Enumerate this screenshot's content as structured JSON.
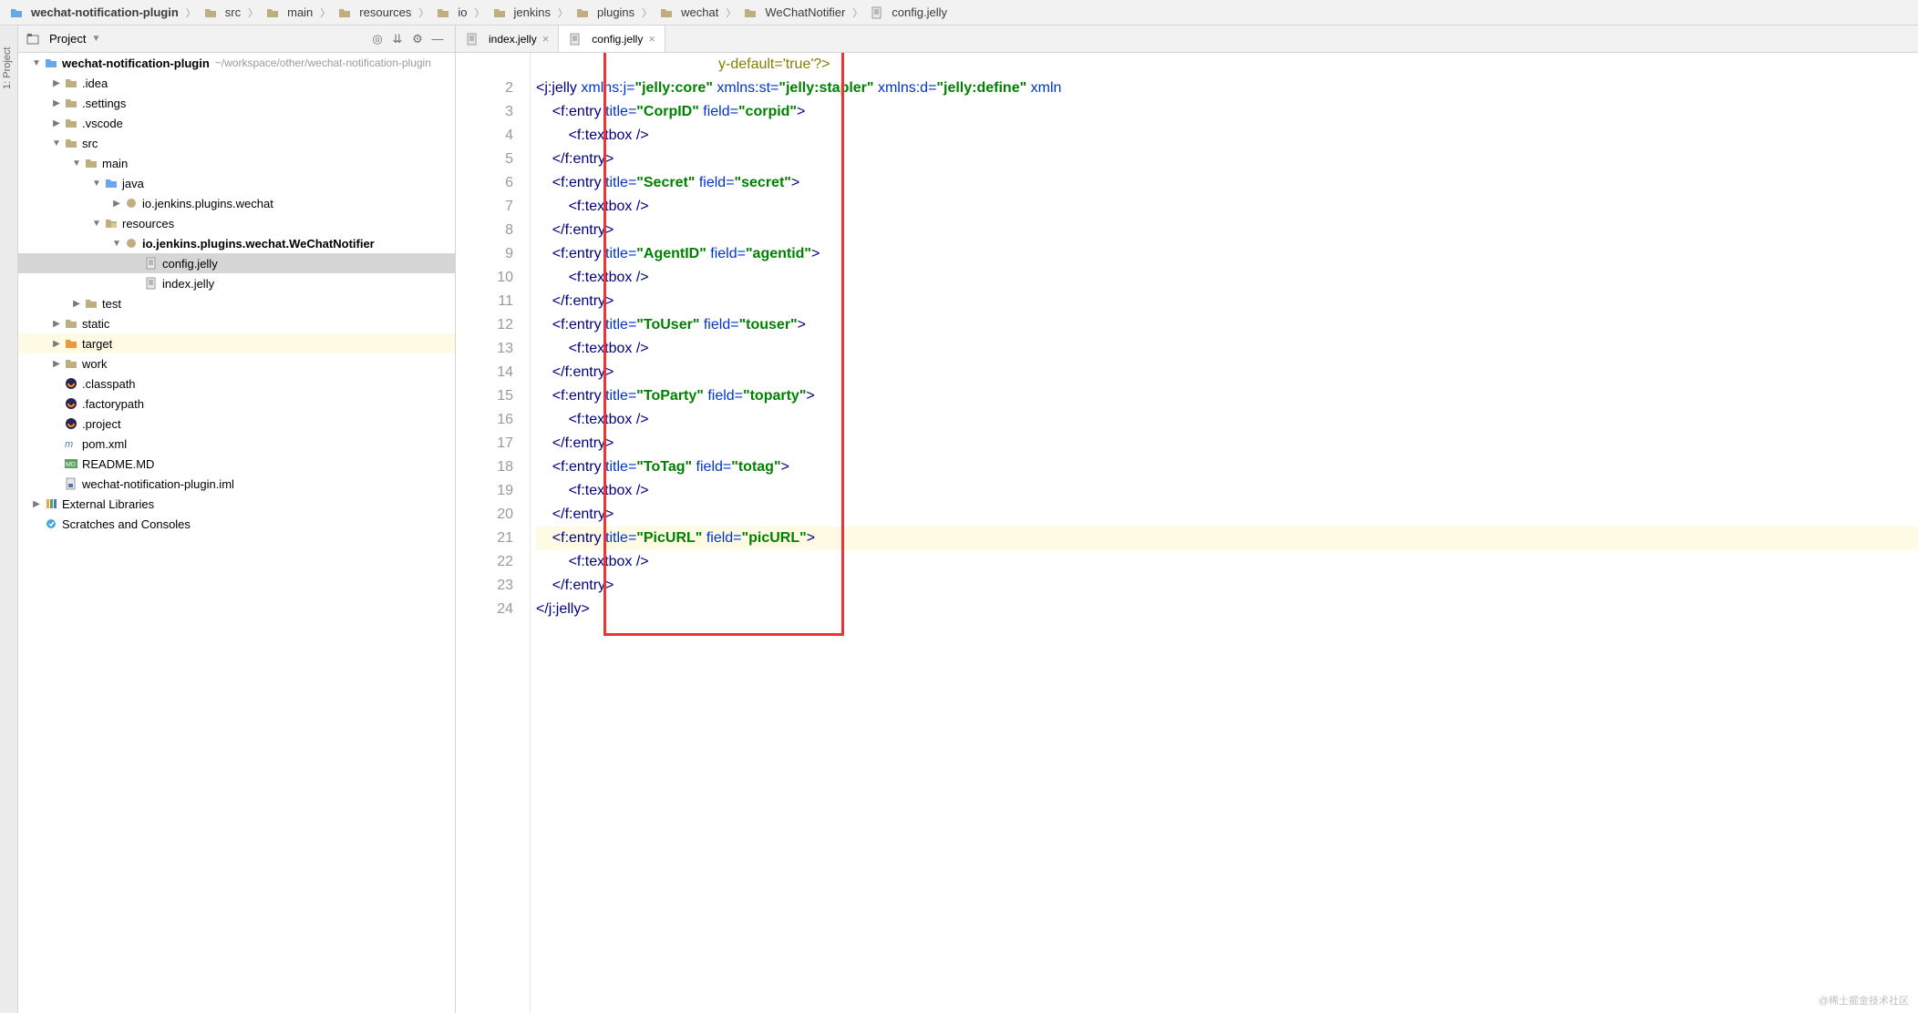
{
  "breadcrumb": [
    {
      "icon": "folder-blue",
      "label": "wechat-notification-plugin"
    },
    {
      "icon": "folder",
      "label": "src"
    },
    {
      "icon": "folder",
      "label": "main"
    },
    {
      "icon": "folder",
      "label": "resources"
    },
    {
      "icon": "folder",
      "label": "io"
    },
    {
      "icon": "folder",
      "label": "jenkins"
    },
    {
      "icon": "folder",
      "label": "plugins"
    },
    {
      "icon": "folder",
      "label": "wechat"
    },
    {
      "icon": "folder",
      "label": "WeChatNotifier"
    },
    {
      "icon": "file",
      "label": "config.jelly"
    }
  ],
  "sidebar": {
    "title": "Project",
    "buttons": [
      "target-icon",
      "flatten-icon",
      "gear-icon",
      "minimize-icon"
    ]
  },
  "tree": [
    {
      "d": 0,
      "a": "down",
      "i": "folder-blue",
      "t": "wechat-notification-plugin",
      "path": "~/workspace/other/wechat-notification-plugin",
      "bold": true
    },
    {
      "d": 1,
      "a": "right",
      "i": "folder",
      "t": ".idea"
    },
    {
      "d": 1,
      "a": "right",
      "i": "folder",
      "t": ".settings"
    },
    {
      "d": 1,
      "a": "right",
      "i": "folder",
      "t": ".vscode"
    },
    {
      "d": 1,
      "a": "down",
      "i": "folder",
      "t": "src"
    },
    {
      "d": 2,
      "a": "down",
      "i": "folder",
      "t": "main"
    },
    {
      "d": 3,
      "a": "down",
      "i": "folder-blue",
      "t": "java"
    },
    {
      "d": 4,
      "a": "right",
      "i": "package",
      "t": "io.jenkins.plugins.wechat"
    },
    {
      "d": 3,
      "a": "down",
      "i": "folder-res",
      "t": "resources"
    },
    {
      "d": 4,
      "a": "down",
      "i": "package",
      "t": "io.jenkins.plugins.wechat.WeChatNotifier",
      "bold": true
    },
    {
      "d": 5,
      "a": "none",
      "i": "file",
      "t": "config.jelly",
      "sel": true
    },
    {
      "d": 5,
      "a": "none",
      "i": "file",
      "t": "index.jelly"
    },
    {
      "d": 2,
      "a": "right",
      "i": "folder",
      "t": "test"
    },
    {
      "d": 1,
      "a": "right",
      "i": "folder",
      "t": "static"
    },
    {
      "d": 1,
      "a": "right",
      "i": "folder-orange",
      "t": "target",
      "hl": true
    },
    {
      "d": 1,
      "a": "right",
      "i": "folder",
      "t": "work"
    },
    {
      "d": 1,
      "a": "none",
      "i": "eclipse",
      "t": ".classpath"
    },
    {
      "d": 1,
      "a": "none",
      "i": "eclipse",
      "t": ".factorypath"
    },
    {
      "d": 1,
      "a": "none",
      "i": "eclipse",
      "t": ".project"
    },
    {
      "d": 1,
      "a": "none",
      "i": "maven",
      "t": "pom.xml"
    },
    {
      "d": 1,
      "a": "none",
      "i": "md",
      "t": "README.MD"
    },
    {
      "d": 1,
      "a": "none",
      "i": "iml",
      "t": "wechat-notification-plugin.iml"
    },
    {
      "d": 0,
      "a": "right",
      "i": "lib",
      "t": "External Libraries"
    },
    {
      "d": 0,
      "a": "none",
      "i": "scratch",
      "t": "Scratches and Consoles"
    }
  ],
  "tabs": [
    {
      "icon": "file",
      "label": "index.jelly",
      "active": false
    },
    {
      "icon": "file",
      "label": "config.jelly",
      "active": true
    }
  ],
  "code": {
    "start": 2,
    "highlight": 21,
    "first_partial": "y-default='true'?>",
    "lines": [
      {
        "n": 2,
        "html": "<span class='c-tag'>&lt;j:jelly</span> <span class='c-attr'>xmlns:j=</span><span class='c-str'>\"jelly:core\"</span> <span class='c-attr'>xmlns:st=</span><span class='c-str'>\"jelly:stapler\"</span> <span class='c-attr'>xmlns:d=</span><span class='c-str'>\"jelly:define\"</span> <span class='c-attr'>xmln</span>"
      },
      {
        "n": 3,
        "html": "    <span class='c-tag'>&lt;f:entry</span> <span class='c-attr'>title=</span><span class='c-str'>\"CorpID\"</span> <span class='c-attr'>field=</span><span class='c-str'>\"corpid\"</span><span class='c-tag'>&gt;</span>"
      },
      {
        "n": 4,
        "html": "        <span class='c-tag'>&lt;f:textbox /&gt;</span>"
      },
      {
        "n": 5,
        "html": "    <span class='c-tag'>&lt;/f:entry&gt;</span>"
      },
      {
        "n": 6,
        "html": "    <span class='c-tag'>&lt;f:entry</span> <span class='c-attr'>title=</span><span class='c-str'>\"Secret\"</span> <span class='c-attr'>field=</span><span class='c-str'>\"secret\"</span><span class='c-tag'>&gt;</span>"
      },
      {
        "n": 7,
        "html": "        <span class='c-tag'>&lt;f:textbox /&gt;</span>"
      },
      {
        "n": 8,
        "html": "    <span class='c-tag'>&lt;/f:entry&gt;</span>"
      },
      {
        "n": 9,
        "html": "    <span class='c-tag'>&lt;f:entry</span> <span class='c-attr'>title=</span><span class='c-str'>\"AgentID\"</span> <span class='c-attr'>field=</span><span class='c-str'>\"agentid\"</span><span class='c-tag'>&gt;</span>"
      },
      {
        "n": 10,
        "html": "        <span class='c-tag'>&lt;f:textbox /&gt;</span>"
      },
      {
        "n": 11,
        "html": "    <span class='c-tag'>&lt;/f:entry&gt;</span>"
      },
      {
        "n": 12,
        "html": "    <span class='c-tag'>&lt;f:entry</span> <span class='c-attr'>title=</span><span class='c-str'>\"ToUser\"</span> <span class='c-attr'>field=</span><span class='c-str'>\"touser\"</span><span class='c-tag'>&gt;</span>"
      },
      {
        "n": 13,
        "html": "        <span class='c-tag'>&lt;f:textbox /&gt;</span>"
      },
      {
        "n": 14,
        "html": "    <span class='c-tag'>&lt;/f:entry&gt;</span>"
      },
      {
        "n": 15,
        "html": "    <span class='c-tag'>&lt;f:entry</span> <span class='c-attr'>title=</span><span class='c-str'>\"ToParty\"</span> <span class='c-attr'>field=</span><span class='c-str'>\"toparty\"</span><span class='c-tag'>&gt;</span>"
      },
      {
        "n": 16,
        "html": "        <span class='c-tag'>&lt;f:textbox /&gt;</span>"
      },
      {
        "n": 17,
        "html": "    <span class='c-tag'>&lt;/f:entry&gt;</span>"
      },
      {
        "n": 18,
        "html": "    <span class='c-tag'>&lt;f:entry</span> <span class='c-attr'>title=</span><span class='c-str'>\"ToTag\"</span> <span class='c-attr'>field=</span><span class='c-str'>\"totag\"</span><span class='c-tag'>&gt;</span>"
      },
      {
        "n": 19,
        "html": "        <span class='c-tag'>&lt;f:textbox /&gt;</span>"
      },
      {
        "n": 20,
        "html": "    <span class='c-tag'>&lt;/f:entry&gt;</span>"
      },
      {
        "n": 21,
        "html": "    <span class='c-tag'>&lt;f:entry</span> <span class='c-attr'>title=</span><span class='c-str'>\"PicURL\"</span> <span class='c-attr'>field=</span><span class='c-str'>\"picURL\"</span><span class='c-tag'>&gt;</span>"
      },
      {
        "n": 22,
        "html": "        <span class='c-tag'>&lt;f:textbox /&gt;</span>"
      },
      {
        "n": 23,
        "html": "    <span class='c-tag'>&lt;/f:entry&gt;</span>"
      },
      {
        "n": 24,
        "html": "<span class='c-tag'>&lt;/j:jelly&gt;</span>"
      }
    ]
  },
  "watermark": "@稀土掘金技术社区",
  "vstrip": "1: Project"
}
